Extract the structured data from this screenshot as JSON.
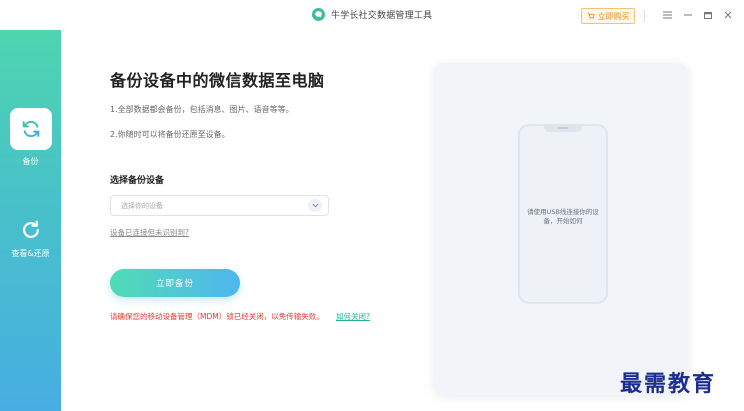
{
  "titlebar": {
    "app_title": "牛学长社交数据管理工具",
    "buy_label": "立即购买",
    "logo_icon": "chat-bubble-icon",
    "controls": [
      "menu-icon",
      "minimize-icon",
      "maximize-icon",
      "close-icon"
    ]
  },
  "sidebar": {
    "items": [
      {
        "label": "备份",
        "icon": "sync-icon",
        "active": true
      },
      {
        "label": "查看&还原",
        "icon": "refresh-icon",
        "active": false
      }
    ]
  },
  "main": {
    "heading": "备份设备中的微信数据至电脑",
    "desc1": "1.全部数据都会备份，包括消息、图片、语音等等。",
    "desc2": "2.你随时可以将备份还原至设备。",
    "select_label": "选择备份设备",
    "select_placeholder": "选择你的设备",
    "help_link": "设备已连接但未识别到?",
    "backup_button": "立即备份",
    "warning": "请确保您的移动设备管理（MDM）锁已经关闭，以免传输失败。",
    "warning_link": "如何关闭?"
  },
  "phone": {
    "hint": "请使用USB线连接你的设备，开始如何"
  },
  "watermark": "最需教育",
  "colors": {
    "accent_green": "#4fd5b0",
    "accent_blue": "#47aee2",
    "warning_red": "#e53935",
    "link_green": "#22b39a",
    "buy_orange": "#e4931d"
  }
}
